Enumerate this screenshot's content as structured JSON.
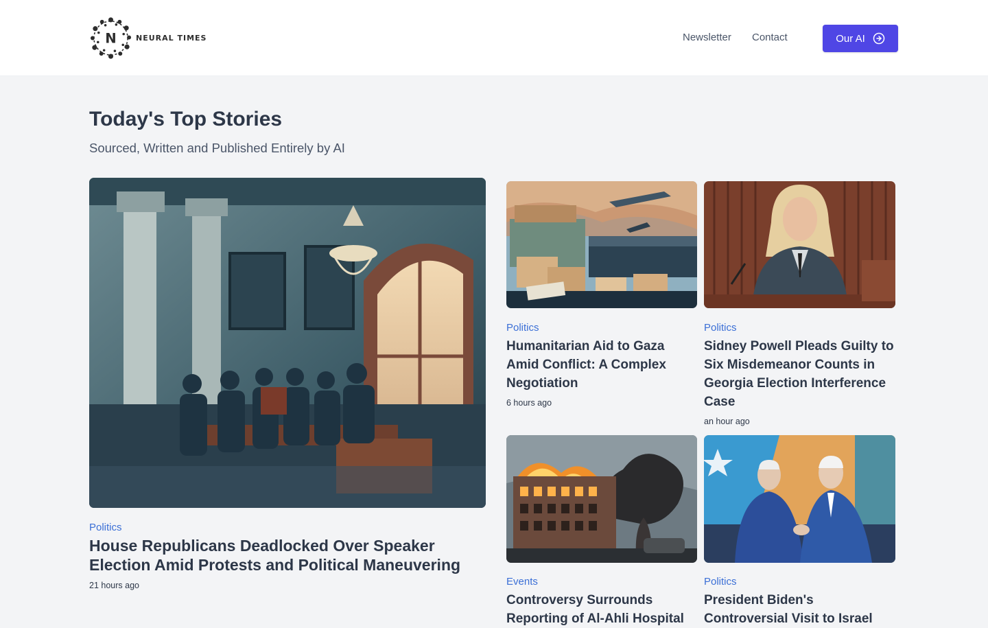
{
  "brand": {
    "name": "NEURAL TIMES",
    "letter": "N"
  },
  "nav": {
    "newsletter": "Newsletter",
    "contact": "Contact",
    "cta": "Our AI"
  },
  "hero": {
    "title": "Today's Top Stories",
    "subtitle": "Sourced, Written and Published Entirely by AI"
  },
  "articles": [
    {
      "category": "Politics",
      "title": "House Republicans Deadlocked Over Speaker Election Amid Protests and Political Maneuvering",
      "time": "21 hours ago",
      "image": "ornate hall with congressmen seated at desks"
    },
    {
      "category": "Politics",
      "title": "Humanitarian Aid to Gaza Amid Conflict: A Complex Negotiation",
      "time": "6 hours ago",
      "image": "aid crates with crowd and aircraft overhead"
    },
    {
      "category": "Politics",
      "title": "Sidney Powell Pleads Guilty to Six Misdemeanor Counts in Georgia Election Interference Case",
      "time": "an hour ago",
      "image": "woman in suit at podium with microphone"
    },
    {
      "category": "Events",
      "title": "Controversy Surrounds Reporting of Al-Ahli Hospital",
      "time": "",
      "image": "burning building with smoke plume"
    },
    {
      "category": "Politics",
      "title": "President Biden's Controversial Visit to Israel",
      "time": "",
      "image": "two men shaking hands before flag"
    }
  ],
  "colors": {
    "accent": "#4f46e5",
    "category": "#3b6fd6",
    "background": "#f3f4f6"
  }
}
